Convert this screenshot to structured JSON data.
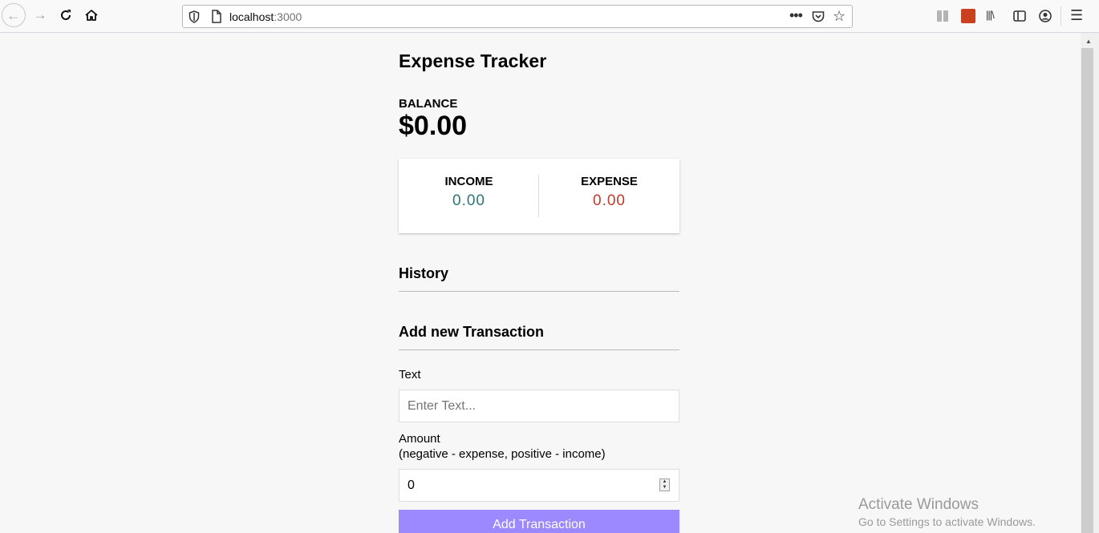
{
  "browser": {
    "url_host": "localhost",
    "url_port": ":3000"
  },
  "app": {
    "title": "Expense Tracker",
    "balance_label": "BALANCE",
    "balance_value": "$0.00",
    "income_label": "INCOME",
    "income_value": "0.00",
    "expense_label": "EXPENSE",
    "expense_value": "0.00",
    "colors": {
      "income": "#2e7477",
      "expense": "#c0392b",
      "button": "#9c88ff"
    }
  },
  "history": {
    "title": "History"
  },
  "form": {
    "title": "Add new Transaction",
    "text_label": "Text",
    "text_placeholder": "Enter Text...",
    "amount_label": "Amount",
    "amount_hint": "(negative - expense, positive - income)",
    "amount_value": "0",
    "submit_label": "Add Transaction"
  },
  "watermark": {
    "title": "Activate Windows",
    "subtitle": "Go to Settings to activate Windows."
  }
}
